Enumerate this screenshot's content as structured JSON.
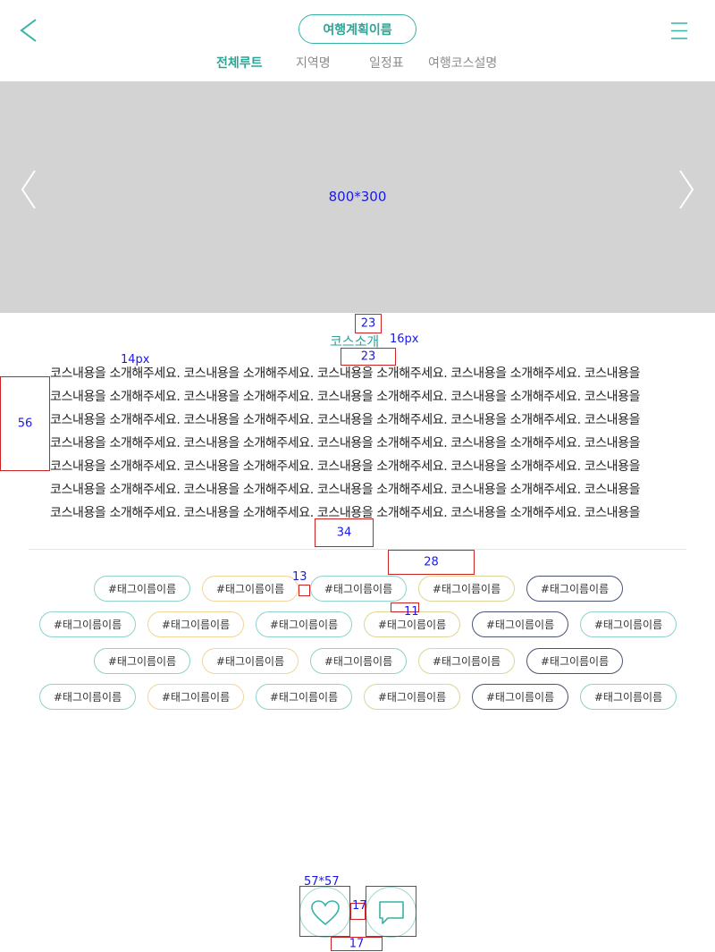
{
  "header": {
    "title": "여행계획이름",
    "tabs": [
      {
        "label": "전체루트",
        "active": true
      },
      {
        "label": "지역명",
        "active": false
      },
      {
        "label": "일정표",
        "active": false
      },
      {
        "label": "여행코스설명",
        "active": false
      }
    ],
    "back_icon": "chevron-left-icon",
    "menu_icon": "hamburger-icon"
  },
  "banner": {
    "label": "800*300",
    "prev_icon": "chevron-left-icon",
    "next_icon": "chevron-right-icon"
  },
  "course": {
    "title": "코스소개",
    "lines": [
      "코스내용을 소개해주세요. 코스내용을 소개해주세요. 코스내용을 소개해주세요. 코스내용을 소개해주세요. 코스내용을",
      "코스내용을 소개해주세요. 코스내용을 소개해주세요. 코스내용을 소개해주세요. 코스내용을 소개해주세요. 코스내용을",
      "코스내용을 소개해주세요. 코스내용을 소개해주세요. 코스내용을 소개해주세요. 코스내용을 소개해주세요. 코스내용을",
      "코스내용을 소개해주세요. 코스내용을 소개해주세요. 코스내용을 소개해주세요. 코스내용을 소개해주세요. 코스내용을",
      "코스내용을 소개해주세요. 코스내용을 소개해주세요. 코스내용을 소개해주세요. 코스내용을 소개해주세요. 코스내용을",
      "코스내용을 소개해주세요. 코스내용을 소개해주세요. 코스내용을 소개해주세요. 코스내용을 소개해주세요. 코스내용을",
      "코스내용을 소개해주세요. 코스내용을 소개해주세요. 코스내용을 소개해주세요. 코스내용을 소개해주세요. 코스내용을"
    ]
  },
  "tags": {
    "rows": [
      [
        "#태그이름이름",
        "#태그이름이름",
        "#태그이름이름",
        "#태그이름이름",
        "#태그이름이름"
      ],
      [
        "#태그이름이름",
        "#태그이름이름",
        "#태그이름이름",
        "#태그이름이름",
        "#태그이름이름",
        "#태그이름이름"
      ],
      [
        "#태그이름이름",
        "#태그이름이름",
        "#태그이름이름",
        "#태그이름이름",
        "#태그이름이름"
      ],
      [
        "#태그이름이름",
        "#태그이름이름",
        "#태그이름이름",
        "#태그이름이름",
        "#태그이름이름",
        "#태그이름이름"
      ]
    ],
    "colors": {
      "teal": "#8fd2ca",
      "orange": "#f1d59a",
      "olive": "#dcd699",
      "navy": "#4b5572"
    }
  },
  "actions": {
    "like_icon": "heart-icon",
    "comment_icon": "speech-bubble-icon"
  },
  "annotations": {
    "gap_top": "23",
    "title_size": "16px",
    "gap_below_title": "23",
    "body_size": "14px",
    "side_margin": "56",
    "gap_after_body": "34",
    "gap_before_tags": "28",
    "tag_gap_x": "13",
    "tag_gap_y": "11",
    "button_size": "57*57",
    "button_gap": "17",
    "bottom_gap": "17"
  },
  "colors": {
    "accent": "#2aa596",
    "banner": "#d3d3d3",
    "annotation_text": "#1a1ae6",
    "annotation_box": "#cc2222"
  }
}
